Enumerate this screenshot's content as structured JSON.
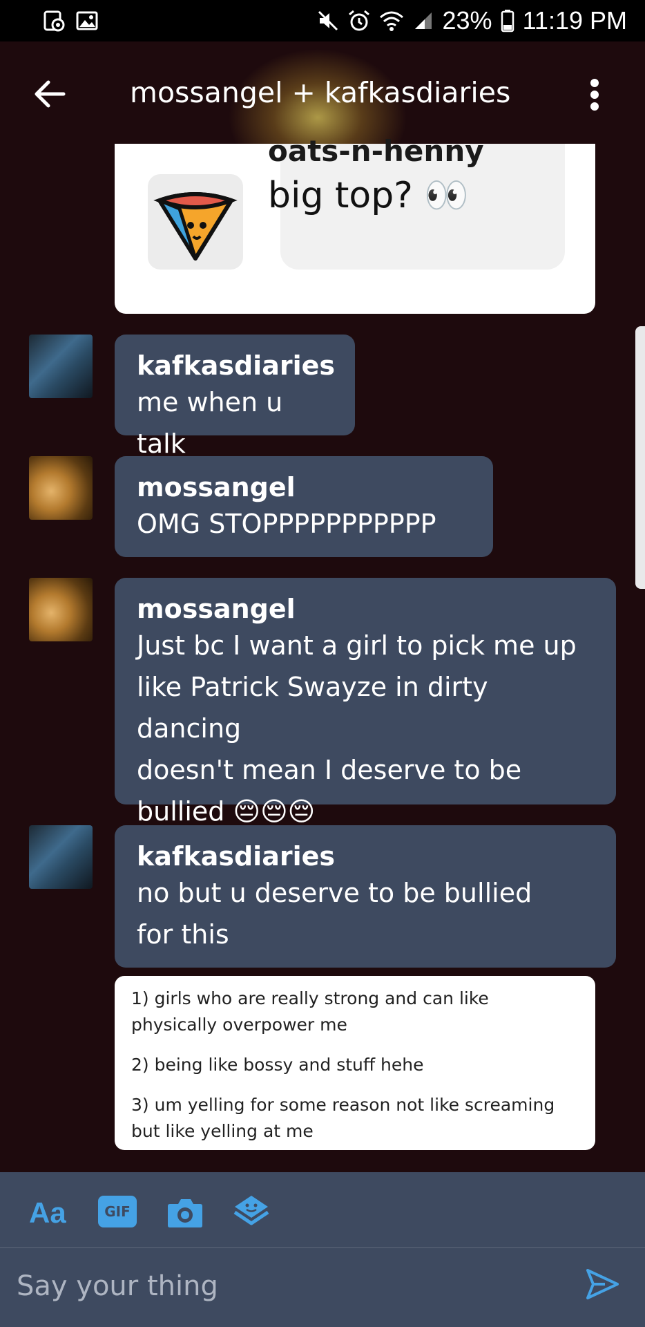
{
  "status_bar": {
    "battery": "23%",
    "time": "11:19 PM"
  },
  "header": {
    "title": "mossangel + kafkasdiaries"
  },
  "shared_post": {
    "blog_name": "oats-n-henny",
    "text": "big top? 👀"
  },
  "messages": [
    {
      "sender": "kafkasdiaries",
      "text": "me when u talk"
    },
    {
      "sender": "mossangel",
      "text": "OMG STOPPPPPPPPPPP"
    },
    {
      "sender": "mossangel",
      "text_line1": "Just bc I want a girl to pick me up",
      "text_line2": "like Patrick Swayze in dirty dancing",
      "text_line3": "doesn't mean I deserve to be",
      "text_line4": "bullied 😔😔😔"
    },
    {
      "sender": "kafkasdiaries",
      "text_line1": "no but u deserve to be bullied",
      "text_line2": "for this"
    }
  ],
  "notes_image": {
    "item1": "1) girls who are really strong and can like physically overpower me",
    "item2": "2) being like bossy and stuff hehe",
    "item3": "3) um yelling for some reason not like screaming but like yelling at me"
  },
  "composer": {
    "text_tool": "Aa",
    "gif_tool": "GIF",
    "placeholder": "Say your thing"
  },
  "colors": {
    "background": "#1e0a0d",
    "bubble": "#3e4a60",
    "accent": "#45a2e5"
  }
}
